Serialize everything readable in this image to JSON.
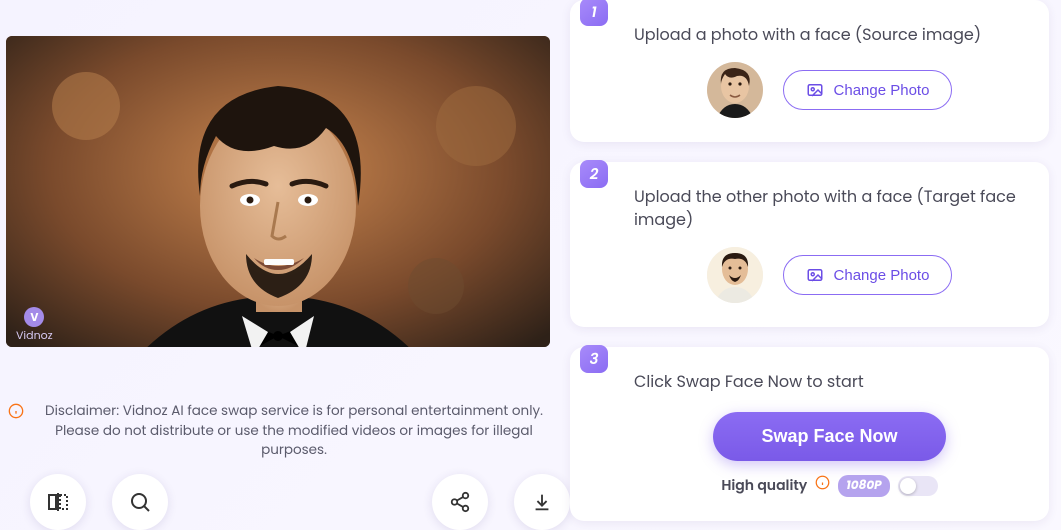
{
  "watermark": {
    "brand": "Vidnoz",
    "letter": "V"
  },
  "disclaimer": {
    "text": "Disclaimer: Vidnoz AI face swap service is for personal entertainment only. Please do not distribute or use the modified videos or images for illegal purposes."
  },
  "steps": {
    "s1": {
      "num": "1",
      "title": "Upload a photo with a face (Source image)",
      "change_label": "Change Photo"
    },
    "s2": {
      "num": "2",
      "title": "Upload the other photo with a face (Target face image)",
      "change_label": "Change Photo"
    },
    "s3": {
      "num": "3",
      "title": "Click Swap Face Now to start"
    }
  },
  "swap_label": "Swap Face Now",
  "hq": {
    "label": "High quality",
    "res": "1080P"
  }
}
